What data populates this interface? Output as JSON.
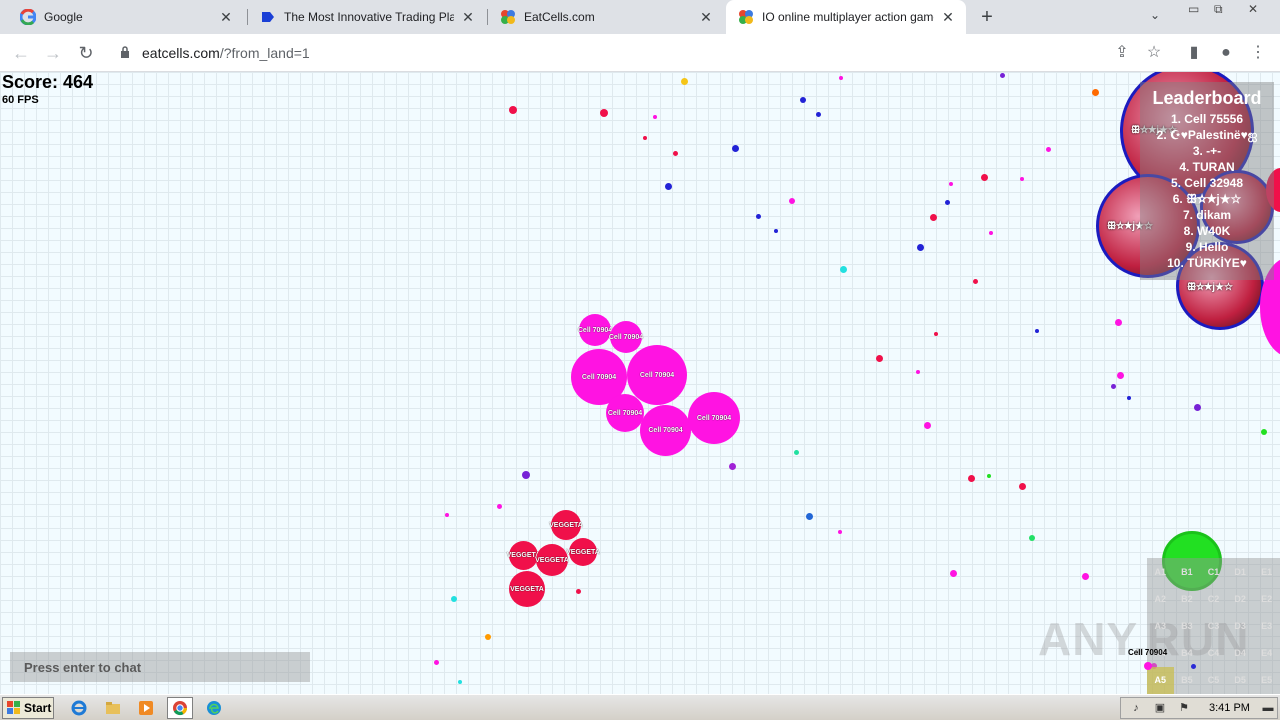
{
  "browser": {
    "tabs": [
      {
        "label": "Google",
        "icon": "google-icon"
      },
      {
        "label": "The Most Innovative Trading Platform",
        "icon": "trading-platform-icon"
      },
      {
        "label": "EatCells.com",
        "icon": "eatcells-icon"
      },
      {
        "label": "IO online multiplayer action game. S",
        "icon": "eatcells-icon",
        "active": true
      }
    ],
    "url_host": "eatcells.com",
    "url_path": "/?from_land=1"
  },
  "game": {
    "score_label": "Score: 464",
    "fps_label": "60 FPS",
    "player_cells": [
      {
        "name": "Cell 70904",
        "color": "#ff13e2"
      },
      {
        "name": "Cell 70904",
        "color": "#ff13e2"
      },
      {
        "name": "Cell 70904",
        "color": "#ff13e2"
      },
      {
        "name": "Cell 70904",
        "color": "#ff13e2"
      },
      {
        "name": "Cell 70904",
        "color": "#ff13e2"
      },
      {
        "name": "Cell 70904",
        "color": "#ff13e2"
      },
      {
        "name": "Cell 70904",
        "color": "#ff13e2"
      }
    ],
    "enemy_cells": [
      {
        "name": "VEGGETA",
        "color": "#f0104a"
      },
      {
        "name": "VEGGETA",
        "color": "#f0104a"
      },
      {
        "name": "VEGGETA",
        "color": "#f0104a"
      },
      {
        "name": "VEGGETA",
        "color": "#f0104a"
      },
      {
        "name": "VEGGETA",
        "color": "#f0104a"
      }
    ],
    "big_cells": [
      {
        "label": "ꕥ☆★j★☆"
      },
      {
        "label": "ꕥ☆★j★☆"
      },
      {
        "label": "ꕥ☆★j★☆"
      }
    ],
    "leaderboard": {
      "title": "Leaderboard",
      "entries": [
        "1. Cell 75556",
        "2. ☪︎♥Palestinë♥ஐ",
        "3. -+-",
        "4. TURAN",
        "5. Cell 32948",
        "6. ꕥ☆★j★☆",
        "7. dikam",
        "8. W40K",
        "9. Hello",
        "10. TÜRKİYE♥"
      ]
    },
    "chat_placeholder": "Press enter to chat",
    "minimap": {
      "cells": [
        "A1",
        "B1",
        "C1",
        "D1",
        "E1",
        "A2",
        "B2",
        "C2",
        "D2",
        "E2",
        "A3",
        "B3",
        "C3",
        "D3",
        "E3",
        "A4",
        "B4",
        "C4",
        "D4",
        "E4",
        "A5",
        "B5",
        "C5",
        "D5",
        "E5"
      ],
      "active_cell": "A5",
      "player_name": "Cell 70904"
    },
    "watermark": "ANY.RUN"
  },
  "taskbar": {
    "start_label": "Start",
    "clock": "3:41 PM"
  }
}
